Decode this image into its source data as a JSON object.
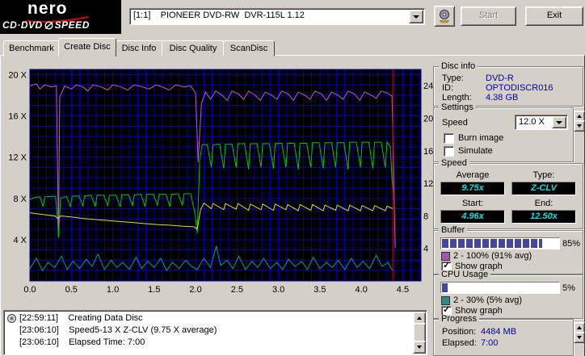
{
  "header": {
    "brand": "nero",
    "brand_sub_left": "CD·DVD",
    "brand_sub_right": "SPEED",
    "drive_selector": "[1:1]    PIONEER DVD-RW  DVR-115L 1.12",
    "start_button": "Start",
    "exit_button": "Exit"
  },
  "tabs": [
    {
      "label": "Benchmark"
    },
    {
      "label": "Create Disc"
    },
    {
      "label": "Disc Info"
    },
    {
      "label": "Disc Quality"
    },
    {
      "label": "ScanDisc"
    }
  ],
  "active_tab": "Create Disc",
  "chart_data": {
    "type": "line",
    "bg": "#000000",
    "grid_color": "#0000a8",
    "grid_x": 0.1,
    "x_max": 4.72,
    "x_ticks": [
      0,
      0.5,
      1,
      1.5,
      2,
      2.5,
      3,
      3.5,
      4,
      4.5
    ],
    "left_axis": {
      "max": 20.5,
      "values": [
        4,
        8,
        12,
        16,
        20
      ],
      "unit": "X"
    },
    "right_axis": {
      "max": 26,
      "values": [
        4,
        8,
        12,
        16,
        20,
        24
      ]
    },
    "cursor_x": 4.38,
    "cursor_color": "#e00000",
    "series": [
      {
        "name": "buffer-level",
        "color": "#c05cc0",
        "points": [
          [
            0,
            18.9
          ],
          [
            0.08,
            19.1
          ],
          [
            0.12,
            18.6
          ],
          [
            0.18,
            19.0
          ],
          [
            0.26,
            18.8
          ],
          [
            0.32,
            18.9
          ],
          [
            0.335,
            10
          ],
          [
            0.345,
            4.2
          ],
          [
            0.36,
            17.8
          ],
          [
            0.42,
            18.9
          ],
          [
            0.5,
            18.6
          ],
          [
            0.56,
            19.0
          ],
          [
            0.64,
            18.8
          ],
          [
            0.7,
            18.4
          ],
          [
            0.76,
            19.0
          ],
          [
            0.86,
            18.8
          ],
          [
            0.94,
            18.5
          ],
          [
            1.0,
            19.0
          ],
          [
            1.1,
            18.8
          ],
          [
            1.18,
            18.5
          ],
          [
            1.26,
            19.0
          ],
          [
            1.36,
            18.8
          ],
          [
            1.44,
            18.6
          ],
          [
            1.52,
            19.0
          ],
          [
            1.6,
            18.8
          ],
          [
            1.68,
            18.5
          ],
          [
            1.76,
            19.0
          ],
          [
            1.86,
            18.8
          ],
          [
            1.94,
            18.9
          ],
          [
            2.0,
            18.2
          ],
          [
            2.03,
            11.5
          ],
          [
            2.07,
            17.2
          ],
          [
            2.12,
            18.3
          ],
          [
            2.18,
            17.6
          ],
          [
            2.24,
            18.4
          ],
          [
            2.32,
            18.0
          ],
          [
            2.38,
            17.5
          ],
          [
            2.44,
            18.4
          ],
          [
            2.52,
            18.1
          ],
          [
            2.58,
            17.6
          ],
          [
            2.64,
            18.4
          ],
          [
            2.72,
            18.0
          ],
          [
            2.78,
            17.5
          ],
          [
            2.84,
            18.3
          ],
          [
            2.92,
            18.0
          ],
          [
            2.98,
            17.6
          ],
          [
            3.04,
            18.4
          ],
          [
            3.12,
            18.1
          ],
          [
            3.18,
            17.5
          ],
          [
            3.24,
            18.3
          ],
          [
            3.32,
            18.0
          ],
          [
            3.38,
            17.6
          ],
          [
            3.44,
            18.4
          ],
          [
            3.52,
            18.1
          ],
          [
            3.58,
            17.5
          ],
          [
            3.64,
            18.3
          ],
          [
            3.72,
            18.0
          ],
          [
            3.78,
            17.6
          ],
          [
            3.84,
            18.4
          ],
          [
            3.92,
            18.1
          ],
          [
            3.98,
            17.5
          ],
          [
            4.04,
            18.3
          ],
          [
            4.12,
            18.0
          ],
          [
            4.18,
            17.7
          ],
          [
            4.24,
            18.4
          ],
          [
            4.32,
            18.2
          ],
          [
            4.37,
            17.9
          ],
          [
            4.39,
            10.0
          ],
          [
            4.41,
            3.2
          ]
        ]
      },
      {
        "name": "write-speed",
        "color": "#00c800",
        "points": [
          [
            0,
            7.9
          ],
          [
            0.06,
            8.1
          ],
          [
            0.12,
            8.15
          ],
          [
            0.16,
            7.2
          ],
          [
            0.18,
            8.15
          ],
          [
            0.26,
            8.2
          ],
          [
            0.31,
            8.2
          ],
          [
            0.335,
            5.8
          ],
          [
            0.345,
            4.2
          ],
          [
            0.37,
            8.0
          ],
          [
            0.44,
            8.2
          ],
          [
            0.49,
            7.2
          ],
          [
            0.51,
            8.2
          ],
          [
            0.59,
            8.25
          ],
          [
            0.64,
            7.3
          ],
          [
            0.66,
            8.25
          ],
          [
            0.74,
            8.3
          ],
          [
            0.79,
            7.2
          ],
          [
            0.81,
            8.3
          ],
          [
            0.89,
            8.3
          ],
          [
            0.94,
            7.3
          ],
          [
            0.96,
            8.3
          ],
          [
            1.04,
            8.3
          ],
          [
            1.09,
            7.2
          ],
          [
            1.11,
            8.35
          ],
          [
            1.19,
            8.35
          ],
          [
            1.24,
            7.3
          ],
          [
            1.26,
            8.35
          ],
          [
            1.34,
            8.4
          ],
          [
            1.39,
            7.2
          ],
          [
            1.41,
            8.4
          ],
          [
            1.49,
            8.4
          ],
          [
            1.54,
            7.3
          ],
          [
            1.56,
            8.4
          ],
          [
            1.64,
            8.4
          ],
          [
            1.69,
            7.2
          ],
          [
            1.71,
            8.4
          ],
          [
            1.79,
            8.45
          ],
          [
            1.84,
            7.3
          ],
          [
            1.86,
            8.45
          ],
          [
            1.94,
            8.45
          ],
          [
            1.99,
            6.6
          ],
          [
            2.02,
            4.6
          ],
          [
            2.05,
            11.8
          ],
          [
            2.08,
            13.2
          ],
          [
            2.14,
            13.2
          ],
          [
            2.19,
            11.0
          ],
          [
            2.21,
            13.2
          ],
          [
            2.29,
            13.25
          ],
          [
            2.34,
            10.9
          ],
          [
            2.36,
            13.25
          ],
          [
            2.44,
            13.25
          ],
          [
            2.49,
            11.0
          ],
          [
            2.51,
            13.3
          ],
          [
            2.59,
            13.3
          ],
          [
            2.64,
            10.8
          ],
          [
            2.66,
            13.3
          ],
          [
            2.74,
            13.3
          ],
          [
            2.79,
            11.0
          ],
          [
            2.81,
            13.3
          ],
          [
            2.89,
            13.3
          ],
          [
            2.94,
            10.9
          ],
          [
            2.96,
            13.3
          ],
          [
            3.04,
            13.35
          ],
          [
            3.09,
            11.0
          ],
          [
            3.11,
            13.35
          ],
          [
            3.19,
            13.35
          ],
          [
            3.24,
            10.8
          ],
          [
            3.26,
            13.35
          ],
          [
            3.34,
            13.35
          ],
          [
            3.39,
            11.0
          ],
          [
            3.41,
            13.4
          ],
          [
            3.49,
            13.4
          ],
          [
            3.54,
            10.9
          ],
          [
            3.56,
            13.4
          ],
          [
            3.64,
            13.4
          ],
          [
            3.69,
            11.0
          ],
          [
            3.71,
            13.4
          ],
          [
            3.79,
            13.4
          ],
          [
            3.84,
            10.8
          ],
          [
            3.86,
            13.45
          ],
          [
            3.94,
            13.45
          ],
          [
            3.99,
            11.0
          ],
          [
            4.01,
            13.45
          ],
          [
            4.09,
            13.45
          ],
          [
            4.14,
            10.9
          ],
          [
            4.16,
            13.45
          ],
          [
            4.24,
            13.45
          ],
          [
            4.29,
            11.0
          ],
          [
            4.31,
            13.45
          ],
          [
            4.35,
            13.0
          ],
          [
            4.38,
            8.5
          ]
        ]
      },
      {
        "name": "average-speed",
        "color": "#e0e000",
        "points": [
          [
            0,
            6.6
          ],
          [
            0.15,
            6.45
          ],
          [
            0.3,
            6.3
          ],
          [
            0.34,
            6.05
          ],
          [
            0.37,
            6.3
          ],
          [
            0.5,
            6.2
          ],
          [
            0.65,
            6.05
          ],
          [
            0.8,
            5.95
          ],
          [
            0.95,
            5.85
          ],
          [
            1.1,
            5.75
          ],
          [
            1.25,
            5.65
          ],
          [
            1.4,
            5.55
          ],
          [
            1.55,
            5.45
          ],
          [
            1.7,
            5.4
          ],
          [
            1.85,
            5.3
          ],
          [
            1.98,
            5.25
          ],
          [
            2.02,
            5.0
          ],
          [
            2.06,
            6.9
          ],
          [
            2.1,
            7.55
          ],
          [
            2.19,
            7.0
          ],
          [
            2.21,
            7.5
          ],
          [
            2.34,
            6.9
          ],
          [
            2.36,
            7.5
          ],
          [
            2.49,
            6.95
          ],
          [
            2.51,
            7.5
          ],
          [
            2.64,
            6.85
          ],
          [
            2.66,
            7.45
          ],
          [
            2.79,
            6.9
          ],
          [
            2.81,
            7.45
          ],
          [
            2.94,
            6.85
          ],
          [
            2.96,
            7.45
          ],
          [
            3.09,
            6.9
          ],
          [
            3.11,
            7.4
          ],
          [
            3.24,
            6.8
          ],
          [
            3.26,
            7.4
          ],
          [
            3.39,
            6.85
          ],
          [
            3.41,
            7.4
          ],
          [
            3.54,
            6.8
          ],
          [
            3.56,
            7.35
          ],
          [
            3.69,
            6.85
          ],
          [
            3.71,
            7.35
          ],
          [
            3.84,
            6.8
          ],
          [
            3.86,
            7.35
          ],
          [
            3.99,
            6.8
          ],
          [
            4.01,
            7.3
          ],
          [
            4.14,
            6.8
          ],
          [
            4.16,
            7.3
          ],
          [
            4.29,
            6.8
          ],
          [
            4.31,
            7.25
          ],
          [
            4.38,
            7.0
          ]
        ]
      },
      {
        "name": "cpu-usage",
        "color": "#00989c",
        "points": [
          [
            0,
            1.2
          ],
          [
            0.08,
            2.2
          ],
          [
            0.15,
            1.0
          ],
          [
            0.22,
            1.8
          ],
          [
            0.3,
            1.3
          ],
          [
            0.38,
            2.4
          ],
          [
            0.45,
            1.1
          ],
          [
            0.52,
            1.9
          ],
          [
            0.6,
            1.2
          ],
          [
            0.68,
            2.1
          ],
          [
            0.75,
            1.4
          ],
          [
            0.82,
            2.6
          ],
          [
            0.9,
            1.1
          ],
          [
            0.98,
            2.0
          ],
          [
            1.05,
            1.3
          ],
          [
            1.12,
            1.8
          ],
          [
            1.2,
            1.1
          ],
          [
            1.28,
            2.3
          ],
          [
            1.35,
            1.2
          ],
          [
            1.42,
            1.9
          ],
          [
            1.5,
            1.3
          ],
          [
            1.58,
            2.2
          ],
          [
            1.65,
            1.0
          ],
          [
            1.72,
            1.8
          ],
          [
            1.8,
            1.2
          ],
          [
            1.88,
            2.0
          ],
          [
            1.95,
            1.4
          ],
          [
            2.02,
            1.1
          ],
          [
            2.1,
            2.2
          ],
          [
            2.18,
            1.3
          ],
          [
            2.25,
            3.4
          ],
          [
            2.3,
            1.5
          ],
          [
            2.38,
            2.0
          ],
          [
            2.45,
            1.2
          ],
          [
            2.52,
            2.4
          ],
          [
            2.6,
            1.1
          ],
          [
            2.68,
            1.9
          ],
          [
            2.75,
            1.3
          ],
          [
            2.82,
            2.2
          ],
          [
            2.9,
            1.2
          ],
          [
            2.98,
            1.8
          ],
          [
            3.05,
            1.1
          ],
          [
            3.12,
            2.1
          ],
          [
            3.2,
            1.4
          ],
          [
            3.28,
            1.9
          ],
          [
            3.35,
            1.1
          ],
          [
            3.42,
            2.3
          ],
          [
            3.5,
            1.2
          ],
          [
            3.58,
            1.8
          ],
          [
            3.65,
            1.3
          ],
          [
            3.72,
            2.0
          ],
          [
            3.8,
            1.1
          ],
          [
            3.88,
            2.2
          ],
          [
            3.95,
            1.3
          ],
          [
            4.02,
            1.9
          ],
          [
            4.1,
            1.2
          ],
          [
            4.18,
            2.5
          ],
          [
            4.25,
            1.4
          ],
          [
            4.32,
            1.8
          ],
          [
            4.38,
            1.0
          ]
        ]
      }
    ]
  },
  "panels": {
    "disc_info": {
      "title": "Disc info",
      "rows": [
        {
          "label": "Type:",
          "value": "DVD-R"
        },
        {
          "label": "ID:",
          "value": "OPTODISCR016"
        },
        {
          "label": "Length:",
          "value": "4.38 GB"
        }
      ]
    },
    "settings": {
      "title": "Settings",
      "speed_label": "Speed",
      "speed_value": "12.0 X",
      "burn_image": {
        "label": "Burn image",
        "mark": ""
      },
      "simulate": {
        "label": "Simulate",
        "mark": ""
      }
    },
    "speed": {
      "title": "Speed",
      "average_label": "Average",
      "average": "9.75x",
      "type_label": "Type:",
      "type": "Z-CLV",
      "start_label": "Start:",
      "start": "4.96x",
      "end_label": "End:",
      "end": "12.50x"
    },
    "buffer": {
      "title": "Buffer",
      "percent": 85,
      "percent_label": "85%",
      "swatch_color": "#a455a8",
      "range_label": "2 - 100% (91% avg)",
      "show_graph": {
        "label": "Show graph",
        "mark": "✓"
      }
    },
    "cpu": {
      "title": "CPU Usage",
      "percent": 5,
      "percent_label": "5%",
      "swatch_color": "#2a8a8a",
      "range_label": "2 - 30% (5% avg)",
      "show_graph": {
        "label": "Show graph",
        "mark": "✓"
      }
    },
    "progress": {
      "title": "Progress",
      "rows": [
        {
          "label": "Position:",
          "value": "4484 MB"
        },
        {
          "label": "Elapsed:",
          "value": "7:00"
        }
      ]
    }
  },
  "log": {
    "lines": [
      {
        "text": "[22:59:11]    Creating Data Disc"
      },
      {
        "text": "[23:06:10]    Speed5-13 X Z-CLV (9.75 X average)"
      },
      {
        "text": "[23:06:10]    Elapsed Time: 7:00"
      }
    ]
  }
}
